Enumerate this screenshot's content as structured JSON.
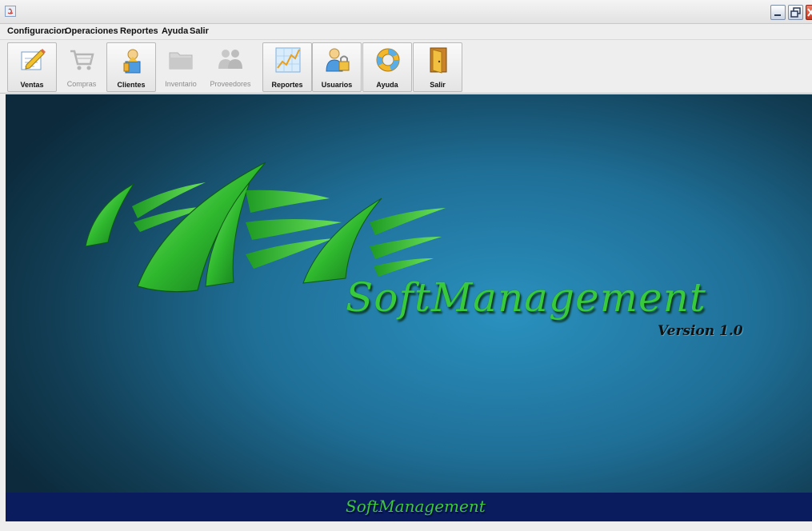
{
  "menu": {
    "items": [
      {
        "label": "Configuracion"
      },
      {
        "label": "Operaciones"
      },
      {
        "label": "Reportes"
      },
      {
        "label": "Ayuda"
      },
      {
        "label": "Salir"
      }
    ]
  },
  "toolbar": {
    "buttons": [
      {
        "label": "Ventas",
        "icon": "pencil-document-icon",
        "enabled": true
      },
      {
        "label": "Compras",
        "icon": "shopping-cart-icon",
        "enabled": false
      },
      {
        "label": "Clientes",
        "icon": "client-person-icon",
        "enabled": true
      },
      {
        "label": "Inventario",
        "icon": "folder-icon",
        "enabled": false
      },
      {
        "label": "Proveedores",
        "icon": "suppliers-group-icon",
        "enabled": false
      },
      {
        "label": "Reportes",
        "icon": "report-chart-icon",
        "enabled": true
      },
      {
        "label": "Usuarios",
        "icon": "user-lock-icon",
        "enabled": true
      },
      {
        "label": "Ayuda",
        "icon": "lifebuoy-icon",
        "enabled": true
      },
      {
        "label": "Salir",
        "icon": "exit-door-icon",
        "enabled": true
      }
    ]
  },
  "banner": {
    "title": "SoftManagement",
    "version": "Version 1.0"
  },
  "footer": {
    "title": "SoftManagement"
  },
  "colors": {
    "brand_green": "#39c93c",
    "banner_blue": "#1f6f97",
    "footer_navy": "#0a1b5e"
  }
}
